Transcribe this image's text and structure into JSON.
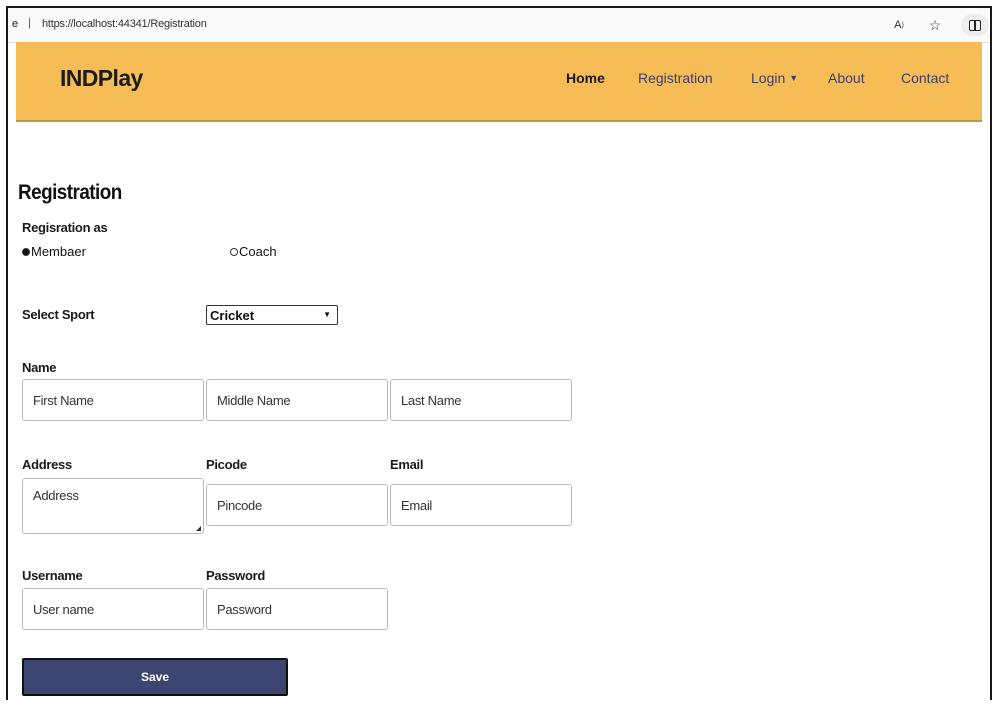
{
  "browser": {
    "prefix": "e",
    "separator": "|",
    "url": "https://localhost:44341/Registration",
    "read_aloud_icon": "read-aloud-icon",
    "favorite_icon": "favorite-star-icon",
    "split_screen_icon": "split-screen-icon"
  },
  "navbar": {
    "brand": "INDPlay",
    "items": [
      {
        "label": "Home"
      },
      {
        "label": "Registration"
      },
      {
        "label": "Login"
      },
      {
        "label": "About"
      },
      {
        "label": "Contact"
      }
    ],
    "background": "#f6bd56"
  },
  "form": {
    "title": "Registration",
    "registration_as_label": "Regisration as",
    "radio_options": [
      {
        "label": "Membaer",
        "selected": true
      },
      {
        "label": "Coach",
        "selected": false
      }
    ],
    "sport_label": "Select Sport",
    "sport_selected": "Cricket",
    "name_label": "Name",
    "first_name_placeholder": "First Name",
    "middle_name_placeholder": "Middle Name",
    "last_name_placeholder": "Last Name",
    "address_label": "Address",
    "address_placeholder": "Address",
    "pincode_label": "Picode",
    "pincode_placeholder": "Pincode",
    "email_label": "Email",
    "email_placeholder": "Email",
    "username_label": "Username",
    "username_placeholder": "User name",
    "password_label": "Password",
    "password_placeholder": "Password",
    "save_label": "Save",
    "save_color": "#3c4570"
  }
}
